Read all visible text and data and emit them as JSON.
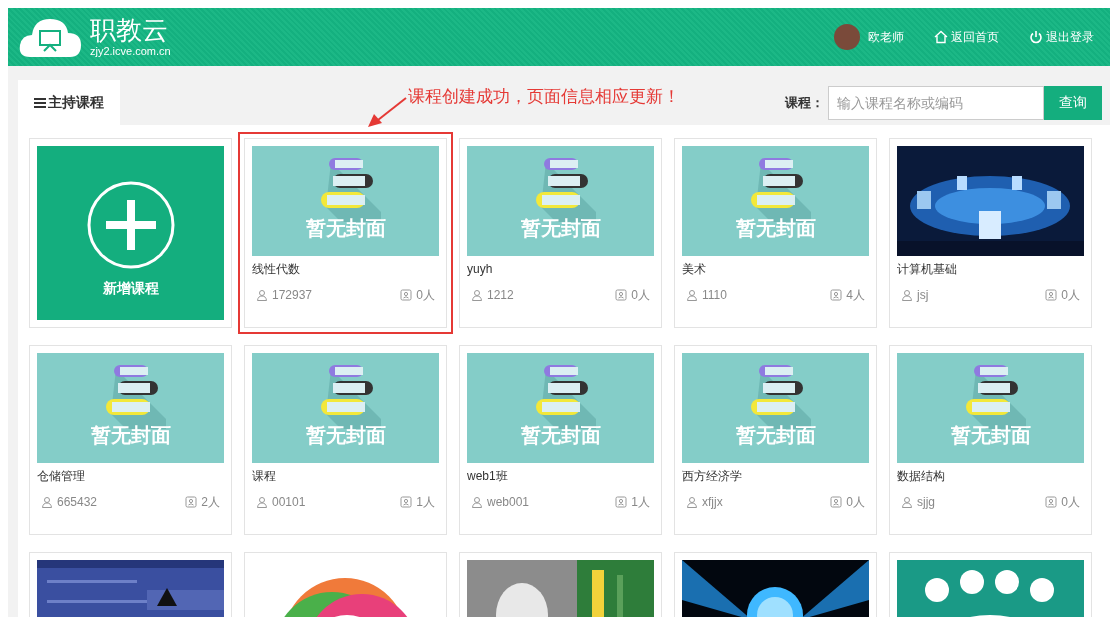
{
  "header": {
    "title": "职教云",
    "subtitle": "zjy2.icve.com.cn",
    "user": "欧老师",
    "links": [
      {
        "kind": "home",
        "label": "返回首页"
      },
      {
        "kind": "logout",
        "label": "退出登录"
      }
    ]
  },
  "tabs": [
    {
      "label": "主持课程",
      "selected": true
    }
  ],
  "annotation": "课程创建成功，页面信息相应更新！",
  "search": {
    "label": "课程：",
    "placeholder": "输入课程名称或编码",
    "button": "查询"
  },
  "cards": [
    {
      "kind": "add",
      "label": "新增课程"
    },
    {
      "kind": "course",
      "cover": {
        "kind": "placeholder",
        "text": "暂无封面"
      },
      "title": "线性代数",
      "code": "172937",
      "count": "0人",
      "highlighted": true
    },
    {
      "kind": "course",
      "cover": {
        "kind": "placeholder",
        "text": "暂无封面"
      },
      "title": "yuyh",
      "code": "1212",
      "count": "0人",
      "highlighted": false
    },
    {
      "kind": "course",
      "cover": {
        "kind": "placeholder",
        "text": "暂无封面"
      },
      "title": "美术",
      "code": "1110",
      "count": "4人",
      "highlighted": false
    },
    {
      "kind": "course",
      "title": "计算机基础",
      "code": "jsj",
      "count": "0人",
      "highlighted": false
    },
    {
      "kind": "course",
      "cover": {
        "kind": "placeholder",
        "text": "暂无封面"
      },
      "title": "仓储管理",
      "code": "665432",
      "count": "2人",
      "highlighted": false
    },
    {
      "kind": "course",
      "cover": {
        "kind": "placeholder",
        "text": "暂无封面"
      },
      "title": "课程",
      "code": "00101",
      "count": "1人",
      "highlighted": false
    },
    {
      "kind": "course",
      "cover": {
        "kind": "placeholder",
        "text": "暂无封面"
      },
      "title": "web1班",
      "code": "web001",
      "count": "1人",
      "highlighted": false
    },
    {
      "kind": "course",
      "cover": {
        "kind": "placeholder",
        "text": "暂无封面"
      },
      "title": "西方经济学",
      "code": "xfjjx",
      "count": "0人",
      "highlighted": false
    },
    {
      "kind": "course",
      "cover": {
        "kind": "placeholder",
        "text": "暂无封面"
      },
      "title": "数据结构",
      "code": "sjjg",
      "count": "0人",
      "highlighted": false
    },
    {
      "kind": "course"
    },
    {
      "kind": "course"
    },
    {
      "kind": "course"
    },
    {
      "kind": "course"
    },
    {
      "kind": "course"
    }
  ]
}
